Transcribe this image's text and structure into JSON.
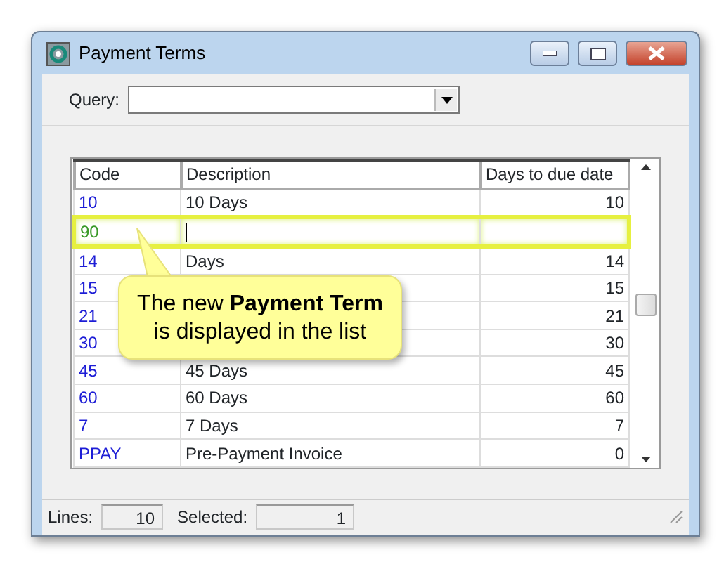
{
  "window": {
    "title": "Payment Terms"
  },
  "query": {
    "label": "Query:"
  },
  "table": {
    "columns": [
      "Code",
      "Description",
      "Days to due date"
    ],
    "rows": [
      {
        "code": "10",
        "description": "10 Days",
        "days": "10",
        "selected": false
      },
      {
        "code": "90",
        "description": "",
        "days": "",
        "selected": true
      },
      {
        "code": "14",
        "description": "Days",
        "days": "14",
        "selected": false
      },
      {
        "code": "15",
        "description": "",
        "days": "15",
        "selected": false
      },
      {
        "code": "21",
        "description": "",
        "days": "21",
        "selected": false
      },
      {
        "code": "30",
        "description": "",
        "days": "30",
        "selected": false
      },
      {
        "code": "45",
        "description": "45 Days",
        "days": "45",
        "selected": false
      },
      {
        "code": "60",
        "description": "60 Days",
        "days": "60",
        "selected": false
      },
      {
        "code": "7",
        "description": "7 Days",
        "days": "7",
        "selected": false
      },
      {
        "code": "PPAY",
        "description": "Pre-Payment Invoice",
        "days": "0",
        "selected": false
      }
    ]
  },
  "callout": "The new **Payment Term** is displayed in the list",
  "status_bar": {
    "lines_label": "Lines:",
    "lines": "10",
    "selected_label": "Selected:",
    "selected": "1"
  }
}
